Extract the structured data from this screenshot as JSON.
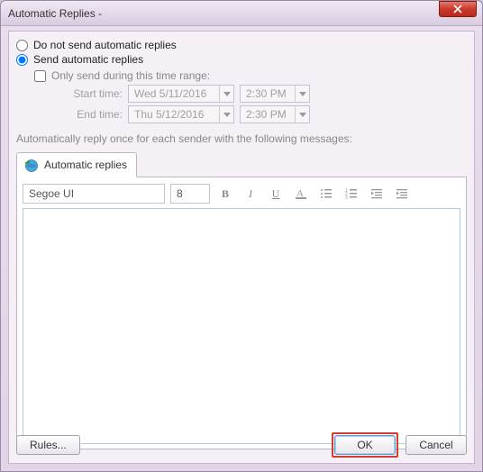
{
  "title": "Automatic Replies -",
  "radios": {
    "no_send": "Do not send automatic replies",
    "send": "Send automatic replies"
  },
  "checkbox": "Only send during this time range:",
  "time": {
    "start_label": "Start time:",
    "end_label": "End time:",
    "start_date": "Wed 5/11/2016",
    "start_time": "2:30 PM",
    "end_date": "Thu 5/12/2016",
    "end_time": "2:30 PM"
  },
  "section_label": "Automatically reply once for each sender with the following messages:",
  "tab_label": "Automatic replies",
  "toolbar": {
    "font": "Segoe UI",
    "size": "8"
  },
  "footer": {
    "rules": "Rules...",
    "ok": "OK",
    "cancel": "Cancel"
  }
}
